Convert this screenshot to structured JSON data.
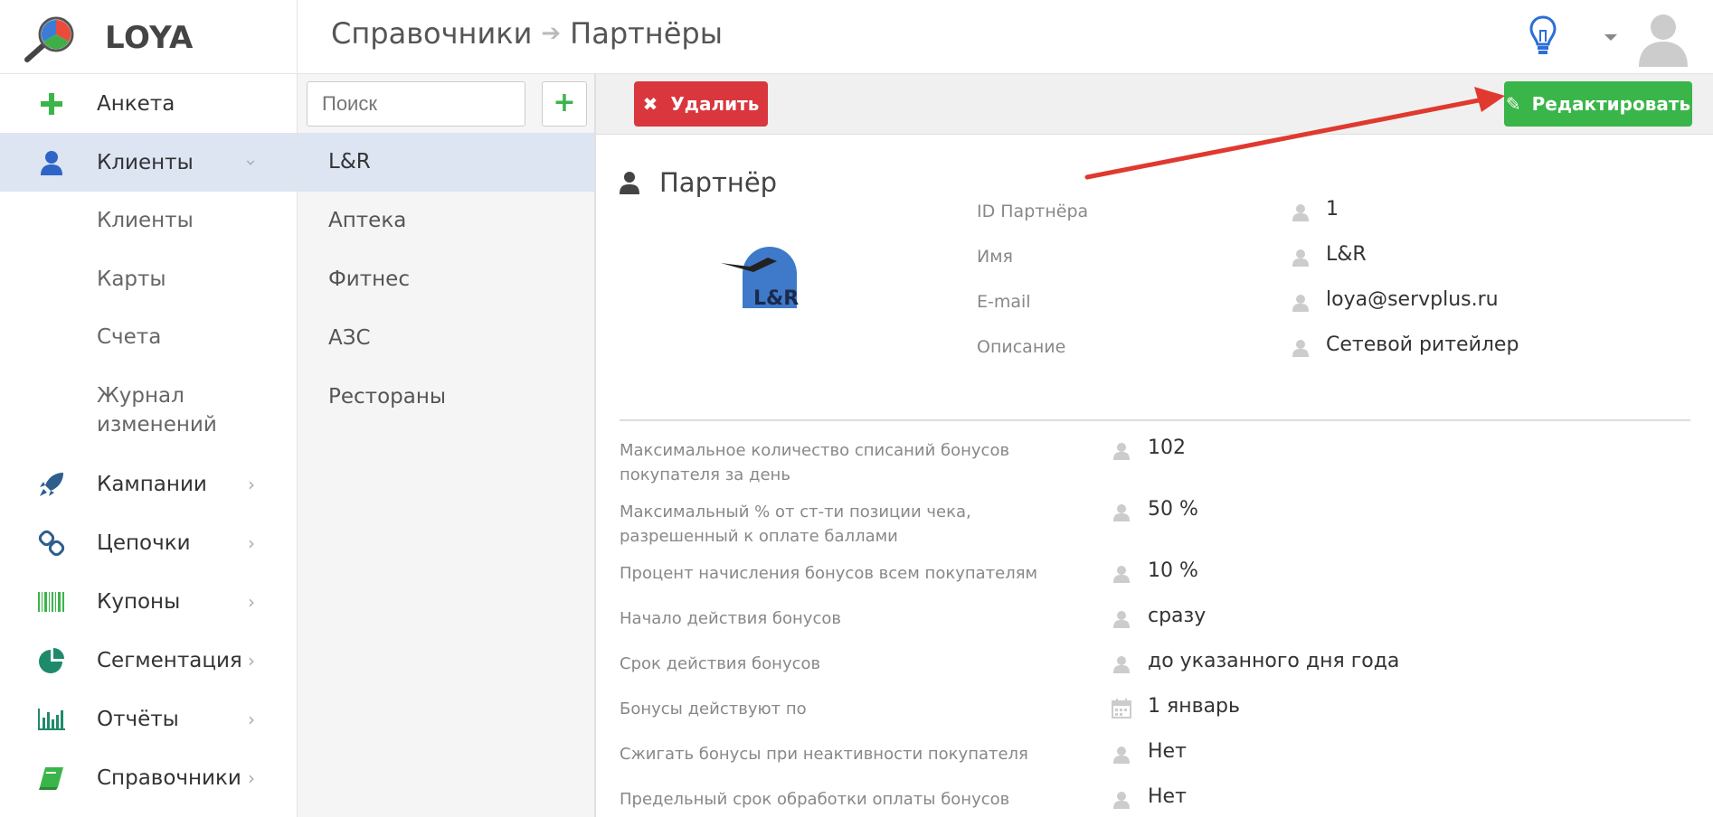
{
  "app": {
    "logo_text": "LOYA"
  },
  "breadcrumb": {
    "parent": "Справочники",
    "current": "Партнёры"
  },
  "header": {
    "bulb_icon": "lightbulb-icon",
    "avatar_icon": "user-avatar-icon"
  },
  "sidebar": {
    "items": [
      {
        "label": "Анкета",
        "icon": "plus-icon"
      },
      {
        "label": "Клиенты",
        "icon": "user-icon",
        "active": true
      },
      {
        "label": "Кампании",
        "icon": "rocket-icon"
      },
      {
        "label": "Цепочки",
        "icon": "link-icon"
      },
      {
        "label": "Купоны",
        "icon": "barcode-icon"
      },
      {
        "label": "Сегментация",
        "icon": "pie-chart-icon"
      },
      {
        "label": "Отчёты",
        "icon": "bar-chart-icon"
      },
      {
        "label": "Справочники",
        "icon": "book-icon"
      }
    ],
    "subitems": [
      "Клиенты",
      "Карты",
      "Счета",
      "Журнал изменений"
    ]
  },
  "list": {
    "search_placeholder": "Поиск",
    "add_label": "+",
    "items": [
      "L&R",
      "Аптека",
      "Фитнес",
      "АЗС",
      "Рестораны"
    ]
  },
  "toolbar": {
    "delete_label": "Удалить",
    "edit_label": "Редактировать"
  },
  "partner": {
    "section_title": "Партнёр",
    "logo_text": "L&R",
    "fields": [
      {
        "label": "ID Партнёра",
        "value": "1"
      },
      {
        "label": "Имя",
        "value": "L&R"
      },
      {
        "label": "E-mail",
        "value": "loya@servplus.ru"
      },
      {
        "label": "Описание",
        "value": "Сетевой ритейлер"
      }
    ],
    "params": [
      {
        "label": "Максимальное количество списаний бонусов покупателя за день",
        "value": "102",
        "icon": "lock-icon"
      },
      {
        "label": "Максимальный % от ст-ти позиции чека, разрешенный к оплате баллами",
        "value": "50 %",
        "icon": "lock-icon"
      },
      {
        "label": "Процент начисления бонусов всем покупателям",
        "value": "10 %",
        "icon": "lock-icon"
      },
      {
        "label": "Начало действия бонусов",
        "value": "сразу",
        "icon": "lock-icon"
      },
      {
        "label": "Срок действия бонусов",
        "value": "до указанного дня года",
        "icon": "lock-icon"
      },
      {
        "label": "Бонусы действуют по",
        "value": "1 январь",
        "icon": "calendar-icon"
      },
      {
        "label": "Сжигать бонусы при неактивности покупателя",
        "value": "Нет",
        "icon": "lock-icon"
      },
      {
        "label": "Предельный срок обработки оплаты бонусов",
        "value": "Нет",
        "icon": "lock-icon"
      }
    ]
  },
  "colors": {
    "delete": "#d9363e",
    "edit": "#3ab54a",
    "active_bg": "#dde4f2",
    "arrow": "#e0392f"
  }
}
